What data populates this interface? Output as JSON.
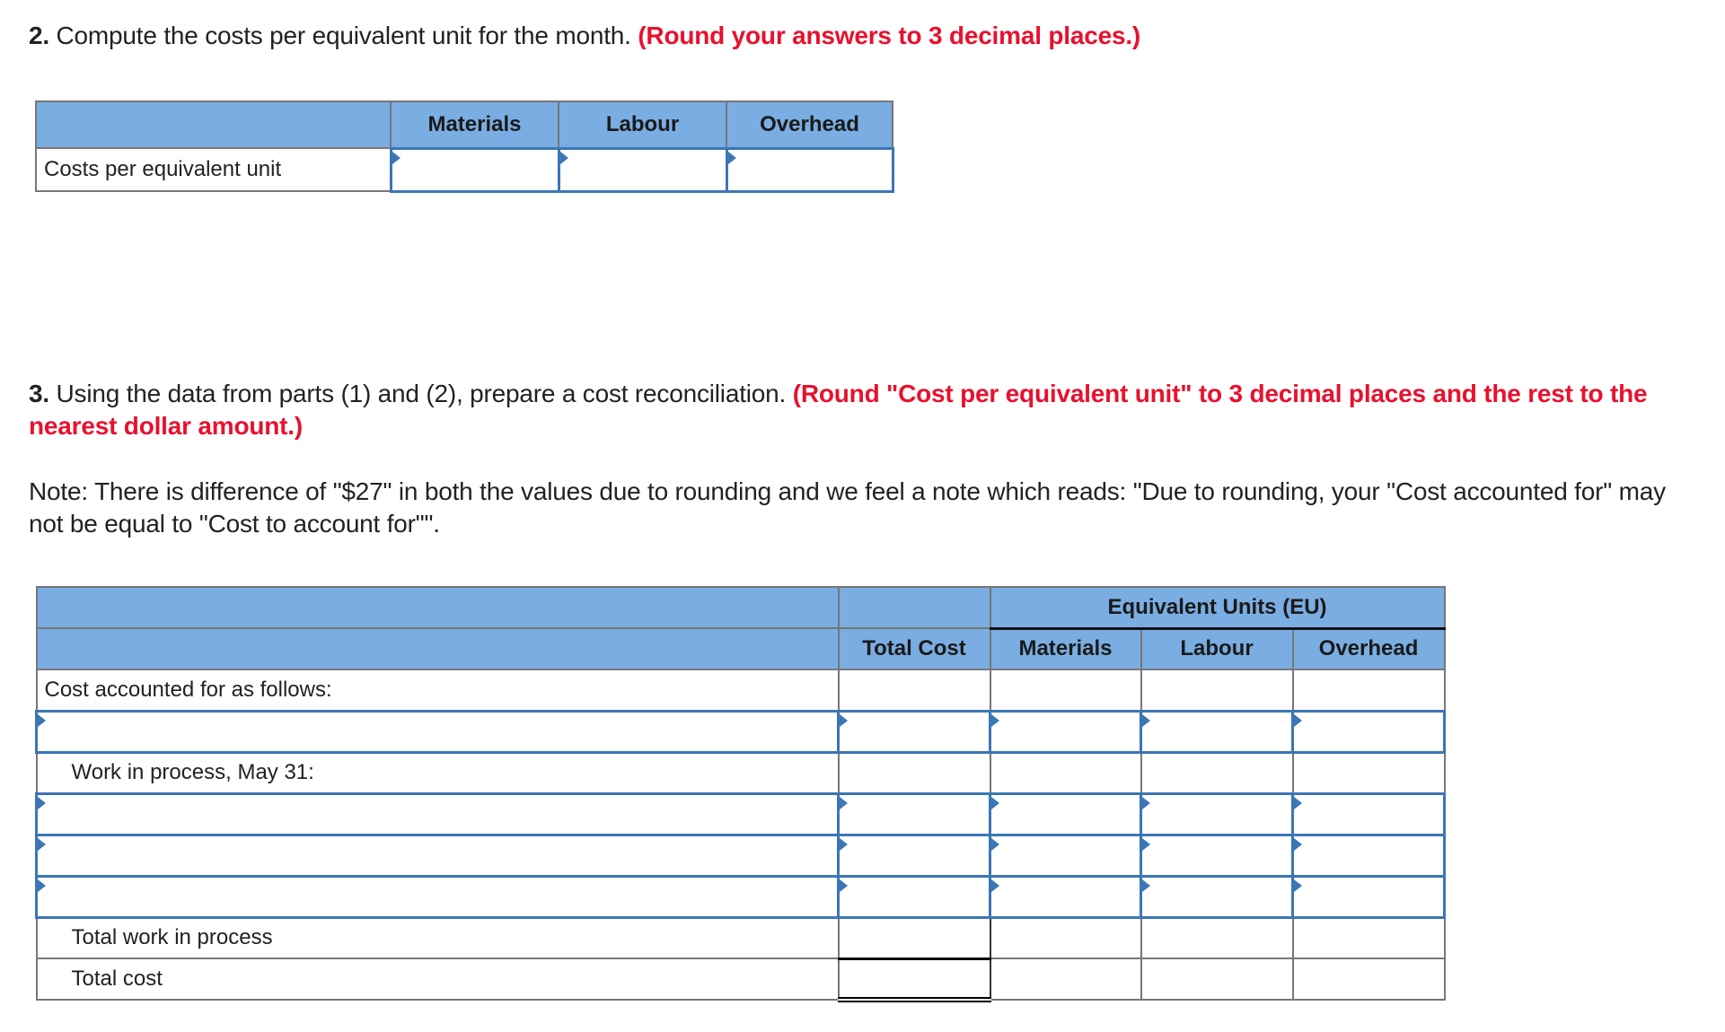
{
  "part2": {
    "number": "2.",
    "text": " Compute the costs per equivalent unit for the month. ",
    "instruction": "(Round your answers to 3 decimal places.)",
    "table": {
      "headers": [
        "",
        "Materials",
        "Labour",
        "Overhead"
      ],
      "row_label": "Costs per equivalent unit",
      "inputs": [
        "",
        "",
        ""
      ]
    }
  },
  "part3": {
    "number": "3.",
    "text": " Using the data from parts (1) and (2), prepare a cost reconciliation. ",
    "instruction": "(Round \"Cost per equivalent unit\" to 3 decimal places and the rest to the nearest dollar amount.)",
    "note": "Note: There is difference of \"$27\" in both the values due to rounding and we feel a note which reads: \"Due to rounding, your \"Cost accounted for\" may not be equal to \"Cost to account for\"\".",
    "table": {
      "group_header": "Equivalent Units (EU)",
      "headers": [
        "",
        "Total Cost",
        "Materials",
        "Labour",
        "Overhead"
      ],
      "rows": {
        "cost_accounted": "Cost accounted for as follows:",
        "wip": "Work in process, May 31:",
        "total_wip": "Total work in process",
        "total_cost": "Total cost"
      }
    }
  }
}
